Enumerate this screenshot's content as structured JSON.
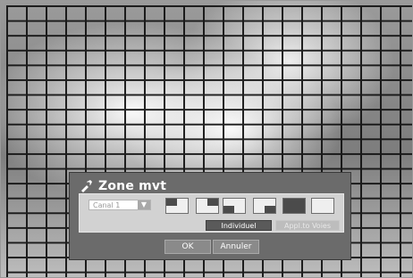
{
  "dialog": {
    "title": "Zone mvt",
    "title_icon": "motion-zone-icon",
    "channel": {
      "selected": "Canal 1",
      "arrow_icon": "chevron-down-icon"
    },
    "zone_presets": [
      {
        "icon": "zone-top-left-icon"
      },
      {
        "icon": "zone-top-right-icon"
      },
      {
        "icon": "zone-bottom-left-icon"
      },
      {
        "icon": "zone-bottom-right-icon"
      },
      {
        "icon": "zone-full-icon"
      },
      {
        "icon": "zone-clear-icon"
      }
    ],
    "individual_label": "Individuel",
    "apply_all_label": "Appl.to Voies",
    "ok_label": "OK",
    "cancel_label": "Annuler"
  },
  "colors": {
    "dialog_bg": "#6b6b6b",
    "panel_bg": "#d2d2d2",
    "grid_line": "#111111"
  }
}
